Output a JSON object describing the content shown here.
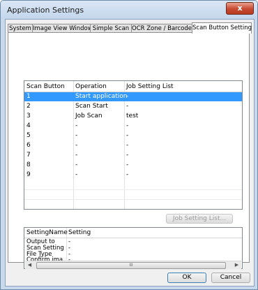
{
  "window": {
    "title": "Application Settings",
    "close_glyph": "x"
  },
  "tabs": [
    {
      "label": "System"
    },
    {
      "label": "Image View Window"
    },
    {
      "label": "Simple Scan"
    },
    {
      "label": "OCR Zone / Barcode"
    },
    {
      "label": "Scan Button Setting"
    }
  ],
  "active_tab": "Scan Button Setting",
  "button_grid": {
    "headers": [
      "Scan Button",
      "Operation",
      "Job Setting List"
    ],
    "rows": [
      {
        "button": "1",
        "operation": "Start application",
        "job": "-",
        "selected": true
      },
      {
        "button": "2",
        "operation": "Scan Start",
        "job": "-"
      },
      {
        "button": "3",
        "operation": "Job Scan",
        "job": "test"
      },
      {
        "button": "4",
        "operation": "-",
        "job": "-"
      },
      {
        "button": "5",
        "operation": "-",
        "job": "-"
      },
      {
        "button": "6",
        "operation": "-",
        "job": "-"
      },
      {
        "button": "7",
        "operation": "-",
        "job": "-"
      },
      {
        "button": "8",
        "operation": "-",
        "job": "-"
      },
      {
        "button": "9",
        "operation": "-",
        "job": "-"
      }
    ],
    "selection_color": "#3399ff"
  },
  "job_setting_list_button": "Job Setting List...",
  "detail": {
    "headers": [
      "SettingName",
      "Setting"
    ],
    "rows": [
      {
        "name": "Output to",
        "value": "-"
      },
      {
        "name": "Scan Setting",
        "value": "-"
      },
      {
        "name": "File Type",
        "value": "-"
      },
      {
        "name": "Confirm ima...",
        "value": "-"
      }
    ],
    "scroll_left": "◀",
    "scroll_right": "▶",
    "scroll_grip": "III"
  },
  "footer": {
    "ok_label": "OK",
    "cancel_label": "Cancel"
  }
}
